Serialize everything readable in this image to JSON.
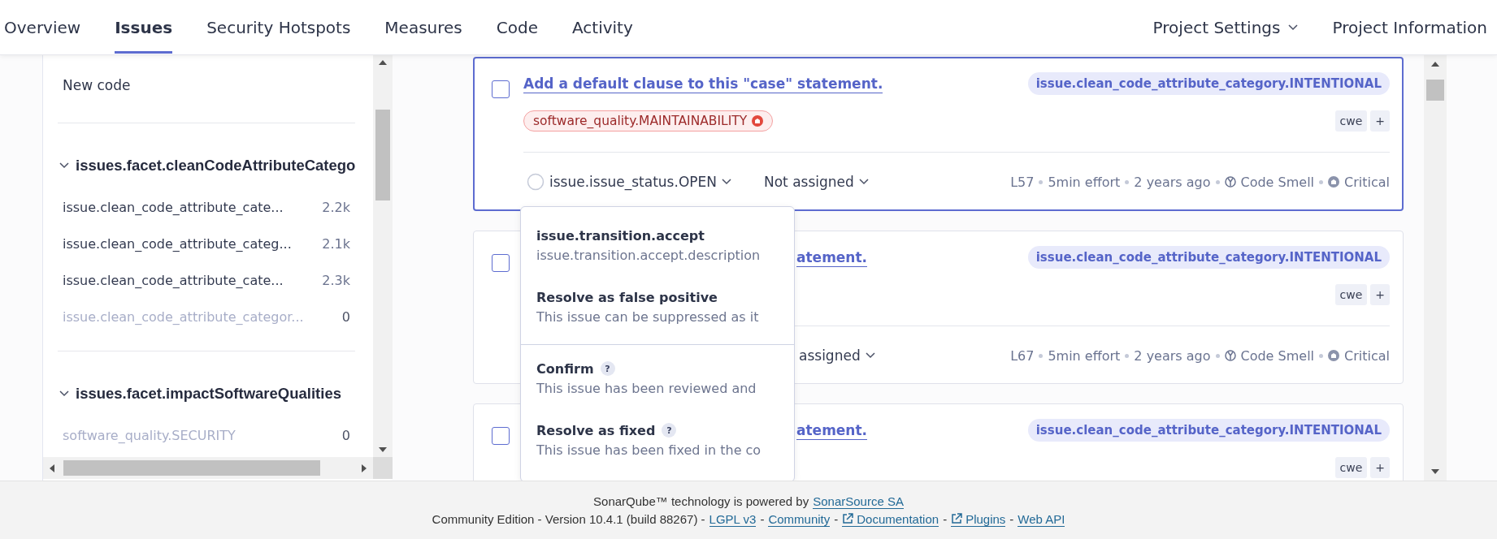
{
  "nav": {
    "tabs": [
      {
        "label": "Overview",
        "selected": false
      },
      {
        "label": "Issues",
        "selected": true
      },
      {
        "label": "Security Hotspots",
        "selected": false
      },
      {
        "label": "Measures",
        "selected": false
      },
      {
        "label": "Code",
        "selected": false
      },
      {
        "label": "Activity",
        "selected": false
      }
    ],
    "right": [
      {
        "label": "Project Settings",
        "has_menu": true
      },
      {
        "label": "Project Information",
        "has_menu": false
      }
    ]
  },
  "sidebar": {
    "new_code": "New code",
    "facets": [
      {
        "title": "issues.facet.cleanCodeAttributeCatego",
        "expanded": true,
        "items": [
          {
            "label": "issue.clean_code_attribute_cate...",
            "count": "2.2k",
            "disabled": false
          },
          {
            "label": "issue.clean_code_attribute_categ...",
            "count": "2.1k",
            "disabled": false
          },
          {
            "label": "issue.clean_code_attribute_cate...",
            "count": "2.3k",
            "disabled": false
          },
          {
            "label": "issue.clean_code_attribute_categor...",
            "count": "0",
            "disabled": true
          }
        ]
      },
      {
        "title": "issues.facet.impactSoftwareQualities",
        "expanded": true,
        "items": [
          {
            "label": "software_quality.SECURITY",
            "count": "0",
            "disabled": true
          }
        ]
      }
    ]
  },
  "issues": [
    {
      "kind": "full",
      "selected": true,
      "checked": false,
      "title": "Add a default clause to this \"case\" statement.",
      "attribute": "issue.clean_code_attribute_category.INTENTIONAL",
      "quality": "software_quality.MAINTAINABILITY",
      "tags": [
        "cwe"
      ],
      "add_tag": "+",
      "status": "issue.issue_status.OPEN",
      "assignee": "Not assigned",
      "meta": {
        "line": "L57",
        "effort": "5min effort",
        "age": "2 years ago",
        "type": "Code Smell",
        "severity": "Critical"
      }
    },
    {
      "kind": "covered",
      "selected": false,
      "checked": false,
      "title": "atement.",
      "attribute": "issue.clean_code_attribute_category.INTENTIONAL",
      "tags": [
        "cwe"
      ],
      "add_tag": "+",
      "assignee": "assigned",
      "meta": {
        "line": "L67",
        "effort": "5min effort",
        "age": "2 years ago",
        "type": "Code Smell",
        "severity": "Critical"
      }
    },
    {
      "kind": "covered",
      "selected": false,
      "checked": false,
      "title": "atement.",
      "attribute": "issue.clean_code_attribute_category.INTENTIONAL",
      "tags": [
        "cwe"
      ],
      "add_tag": "+"
    }
  ],
  "status_menu": {
    "items": [
      {
        "title": "issue.transition.accept",
        "description": "issue.transition.accept.description",
        "divider_before": false
      },
      {
        "title": "Resolve as false positive",
        "description": "This issue can be suppressed as it",
        "divider_before": false
      },
      {
        "title": "Confirm",
        "help": "?",
        "description": "This issue has been reviewed and",
        "divider_before": true
      },
      {
        "title": "Resolve as fixed",
        "help": "?",
        "description": "This issue has been fixed in the co",
        "divider_before": false
      }
    ]
  },
  "footer": {
    "lines": [
      [
        {
          "kind": "text",
          "text": "SonarQube™ technology is powered by"
        },
        {
          "kind": "link",
          "text": "SonarSource SA",
          "external": false
        }
      ],
      [
        {
          "kind": "text",
          "text": "Community Edition - Version 10.4.1 (build 88267) -"
        },
        {
          "kind": "link",
          "text": "LGPL v3",
          "external": false
        },
        {
          "kind": "text",
          "text": "-"
        },
        {
          "kind": "link",
          "text": "Community",
          "external": false
        },
        {
          "kind": "text",
          "text": "-"
        },
        {
          "kind": "link",
          "text": "Documentation",
          "external": true
        },
        {
          "kind": "text",
          "text": "-"
        },
        {
          "kind": "link",
          "text": "Plugins",
          "external": true
        },
        {
          "kind": "text",
          "text": "-"
        },
        {
          "kind": "link",
          "text": "Web API",
          "external": false
        }
      ]
    ]
  }
}
